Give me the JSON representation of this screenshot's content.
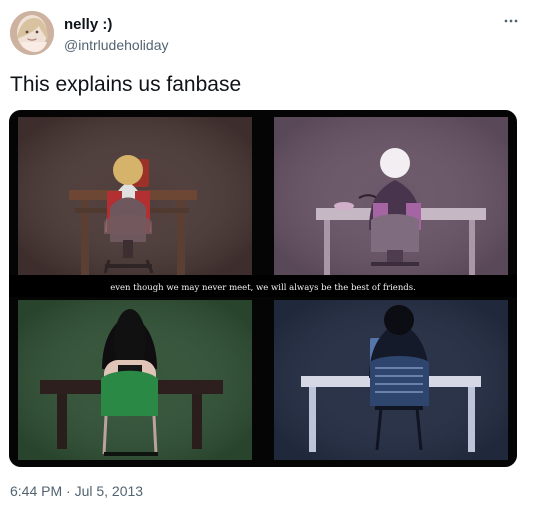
{
  "tweet": {
    "display_name": "nelly :)",
    "handle": "@intrludeholiday",
    "text": "This explains us fanbase",
    "timestamp": "6:44 PM · Jul 5, 2013"
  },
  "media": {
    "caption": "even though we may never meet, we will always be the best of friends.",
    "panel_colors": {
      "top_left": "#4b3937",
      "top_right": "#695567",
      "bottom_left": "#315236",
      "bottom_right": "#252e45"
    }
  },
  "icons": {
    "avatar": "avatar",
    "more": "more-options-icon"
  }
}
